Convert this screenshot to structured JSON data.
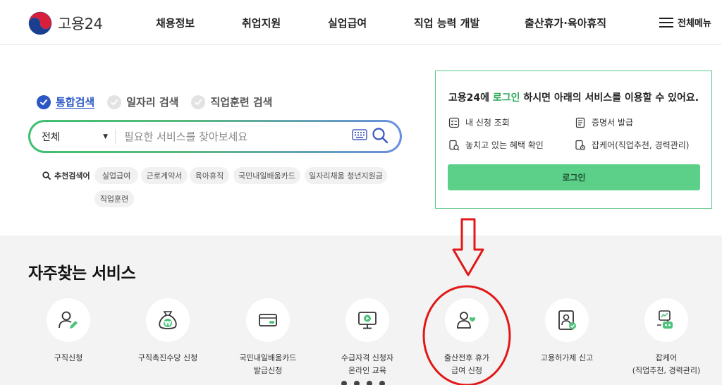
{
  "header": {
    "logo_text": "고용24",
    "nav": [
      "채용정보",
      "취업지원",
      "실업급여",
      "직업 능력 개발",
      "출산휴가·육아휴직"
    ],
    "all_menu_label": "전체메뉴"
  },
  "search": {
    "tabs": [
      {
        "label": "통합검색",
        "active": true
      },
      {
        "label": "일자리 검색",
        "active": false
      },
      {
        "label": "직업훈련 검색",
        "active": false
      }
    ],
    "scope": "전체",
    "placeholder": "필요한 서비스를 찾아보세요",
    "recommended_label": "추천검색어",
    "recommended": [
      "실업급여",
      "근로계약서",
      "육아휴직",
      "국민내일배움카드",
      "일자리채움 청년지원금",
      "직업훈련"
    ]
  },
  "login": {
    "title_prefix": "고용24에 ",
    "title_link": "로그인",
    "title_suffix": " 하시면 아래의 서비스를 이용할 수 있어요.",
    "items": [
      "내 신청 조회",
      "증명서 발급",
      "놓치고 있는 혜택 확인",
      "잡케어(직업추천, 경력관리)"
    ],
    "button": "로그인"
  },
  "services": {
    "title": "자주찾는 서비스",
    "items": [
      {
        "label": "구직신청",
        "icon": "person-edit-icon"
      },
      {
        "label": "구직촉진수당 신청",
        "icon": "money-bag-icon"
      },
      {
        "label": "국민내일배움카드\n발급신청",
        "icon": "card-icon"
      },
      {
        "label": "수급자격 신청자\n온라인 교육",
        "icon": "monitor-play-icon"
      },
      {
        "label": "출산전후 휴가\n급여 신청",
        "icon": "parent-heart-icon"
      },
      {
        "label": "고용허가제 신고",
        "icon": "id-check-icon"
      },
      {
        "label": "잡케어\n(직업추천, 경력관리)",
        "icon": "robot-icon"
      }
    ]
  },
  "colors": {
    "brand_blue": "#2a56c6",
    "brand_green": "#2fa85d",
    "button_green": "#5cd089",
    "annotation_red": "#e01818"
  }
}
